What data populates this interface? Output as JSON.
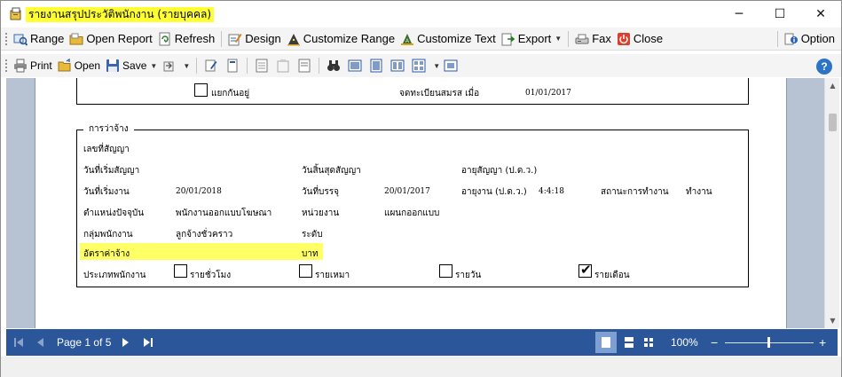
{
  "window": {
    "title": "รายงานสรุปประวัติพนักงาน (รายบุคคล)",
    "minimize": "─",
    "maximize": "☐",
    "close": "✕"
  },
  "toolbar": {
    "range": "Range",
    "open_report": "Open Report",
    "refresh": "Refresh",
    "design": "Design",
    "customize_range": "Customize Range",
    "customize_text": "Customize Text",
    "export": "Export",
    "fax": "Fax",
    "close": "Close",
    "option": "Option"
  },
  "viewer_toolbar": {
    "print": "Print",
    "open": "Open",
    "save": "Save",
    "help": "?"
  },
  "report": {
    "top_section": {
      "separated_label": "แยกกันอยู่",
      "marriage_reg_label": "จดทะเบียนสมรส เมื่อ",
      "marriage_reg_date": "01/01/2017"
    },
    "employment": {
      "legend": "การว่าจ้าง",
      "contract_no_label": "เลขที่สัญญา",
      "contract_start_label": "วันที่เริ่มสัญญา",
      "contract_end_label": "วันสิ้นสุดสัญญา",
      "contract_age_label": "อายุสัญญา (ป.ด.ว.)",
      "work_start_label": "วันที่เริ่มงาน",
      "work_start_value": "20/01/2018",
      "confirm_date_label": "วันที่บรรจุ",
      "confirm_date_value": "20/01/2017",
      "work_age_label": "อายุงาน (ป.ด.ว.)",
      "work_age_value": "4:4:18",
      "work_status_label": "สถานะการทำงาน",
      "work_status_value": "ทำงาน",
      "position_label": "ตำแหน่งปัจจุบัน",
      "position_value": "พนักงานออกแบบโฆษณา",
      "unit_label": "หน่วยงาน",
      "unit_value": "แผนกออกแบบ",
      "group_label": "กลุ่มพนักงาน",
      "group_value": "ลูกจ้างชั่วคราว",
      "level_label": "ระดับ",
      "wage_label": "อัตราค่าจ้าง",
      "wage_unit": "บาท",
      "emp_type_label": "ประเภทพนักงาน",
      "type_hourly": "รายชั่วโมง",
      "type_lump": "รายเหมา",
      "type_daily": "รายวัน",
      "type_monthly": "รายเดือน"
    }
  },
  "statusbar": {
    "page_info": "Page 1 of 5",
    "zoom": "100%"
  },
  "colors": {
    "title_highlight": "#ffff33",
    "status_bar": "#2b579a",
    "report_background": "#b7c3d3",
    "wage_highlight": "#ffff66"
  }
}
